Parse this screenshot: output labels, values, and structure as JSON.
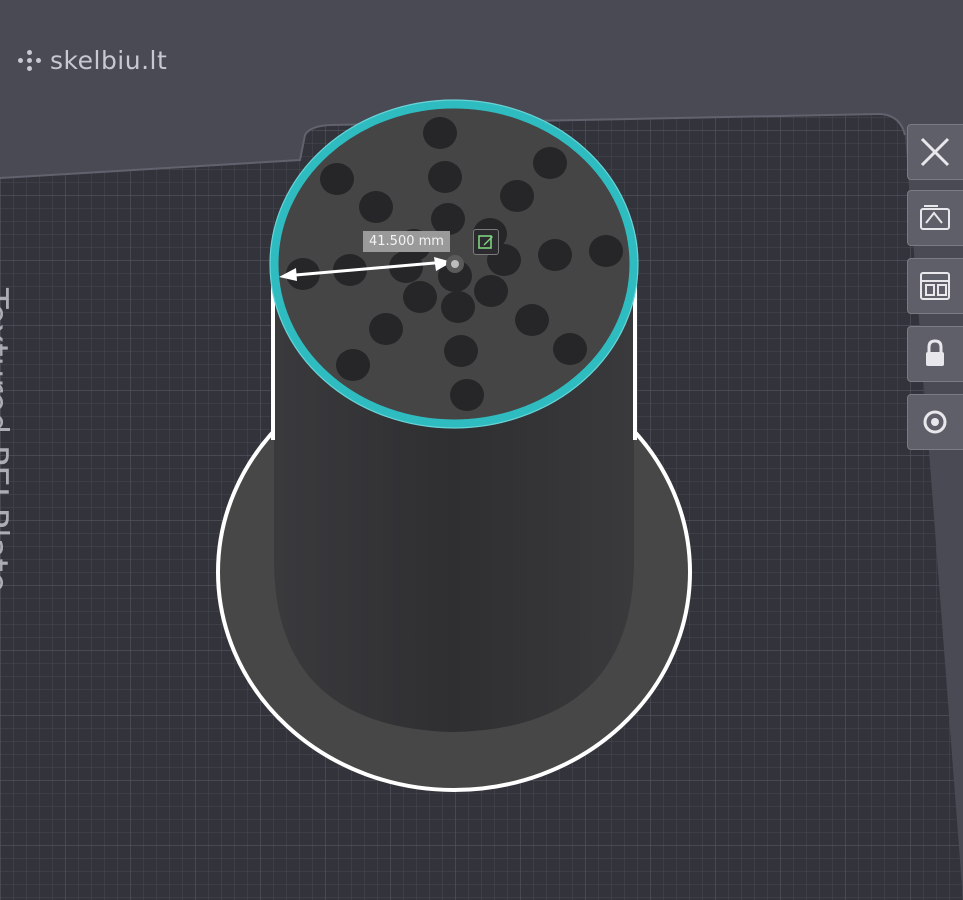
{
  "watermark": {
    "text": "skelbiu.lt",
    "icon": "dots-logo-icon"
  },
  "plate": {
    "label": "Textured PEI Plate",
    "background_color": "#4a4a54",
    "plate_color": "#33333b",
    "grid_color": "#52525d"
  },
  "measurement": {
    "value_text": "41.500 mm",
    "edit_icon": "edit-pencil-icon",
    "accent_color": "#2fbcc0"
  },
  "model": {
    "holes_count": 25,
    "outline_color": "#ffffff"
  },
  "toolbar": {
    "items": [
      {
        "name": "close-icon"
      },
      {
        "name": "auto-orient-icon"
      },
      {
        "name": "arrange-icon"
      },
      {
        "name": "lock-icon"
      },
      {
        "name": "settings-icon"
      }
    ]
  }
}
